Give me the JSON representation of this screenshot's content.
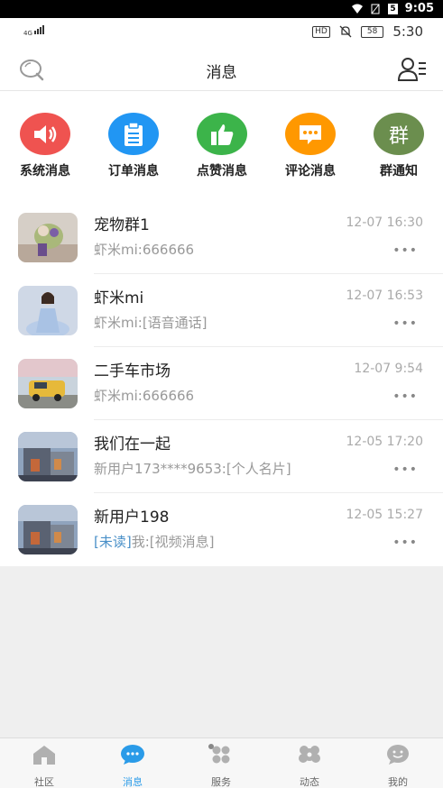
{
  "system_status": {
    "time": "9:05",
    "battery_badge": "5"
  },
  "status_bar": {
    "network": "4G",
    "hd": "HD",
    "battery": "58",
    "time": "5:30"
  },
  "header": {
    "title": "消息"
  },
  "shortcuts": [
    {
      "label": "系统消息",
      "color": "#ef5350",
      "icon": "speaker-icon"
    },
    {
      "label": "订单消息",
      "color": "#2196f3",
      "icon": "clipboard-icon"
    },
    {
      "label": "点赞消息",
      "color": "#3cb44a",
      "icon": "thumbs-up-icon"
    },
    {
      "label": "评论消息",
      "color": "#ff9800",
      "icon": "comment-icon"
    },
    {
      "label": "群通知",
      "color": "#6b8e4e",
      "icon": "group-badge-icon",
      "glyph": "群"
    }
  ],
  "conversations": [
    {
      "name": "宠物群1",
      "time": "12-07 16:30",
      "message": "虾米mi:666666",
      "unread_tag": "",
      "more": "•••"
    },
    {
      "name": "虾米mi",
      "time": "12-07 16:53",
      "message": "虾米mi:[语音通话]",
      "unread_tag": "",
      "more": "•••"
    },
    {
      "name": "二手车市场",
      "time": "12-07 9:54",
      "message": "虾米mi:666666",
      "unread_tag": "",
      "more": "•••"
    },
    {
      "name": "我们在一起",
      "time": "12-05 17:20",
      "message": "新用户173****9653:[个人名片]",
      "unread_tag": "",
      "more": "•••"
    },
    {
      "name": "新用户198",
      "time": "12-05 15:27",
      "message": "我:[视频消息]",
      "unread_tag": "[未读]",
      "more": "•••"
    }
  ],
  "tabbar": [
    {
      "label": "社区",
      "icon": "home-icon",
      "active": false
    },
    {
      "label": "消息",
      "icon": "chat-bubble-icon",
      "active": true
    },
    {
      "label": "服务",
      "icon": "grid-icon",
      "active": false
    },
    {
      "label": "动态",
      "icon": "flower-icon",
      "active": false
    },
    {
      "label": "我的",
      "icon": "smiley-icon",
      "active": false
    }
  ],
  "colors": {
    "accent": "#2a9be8",
    "unread": "#4a90c8"
  }
}
